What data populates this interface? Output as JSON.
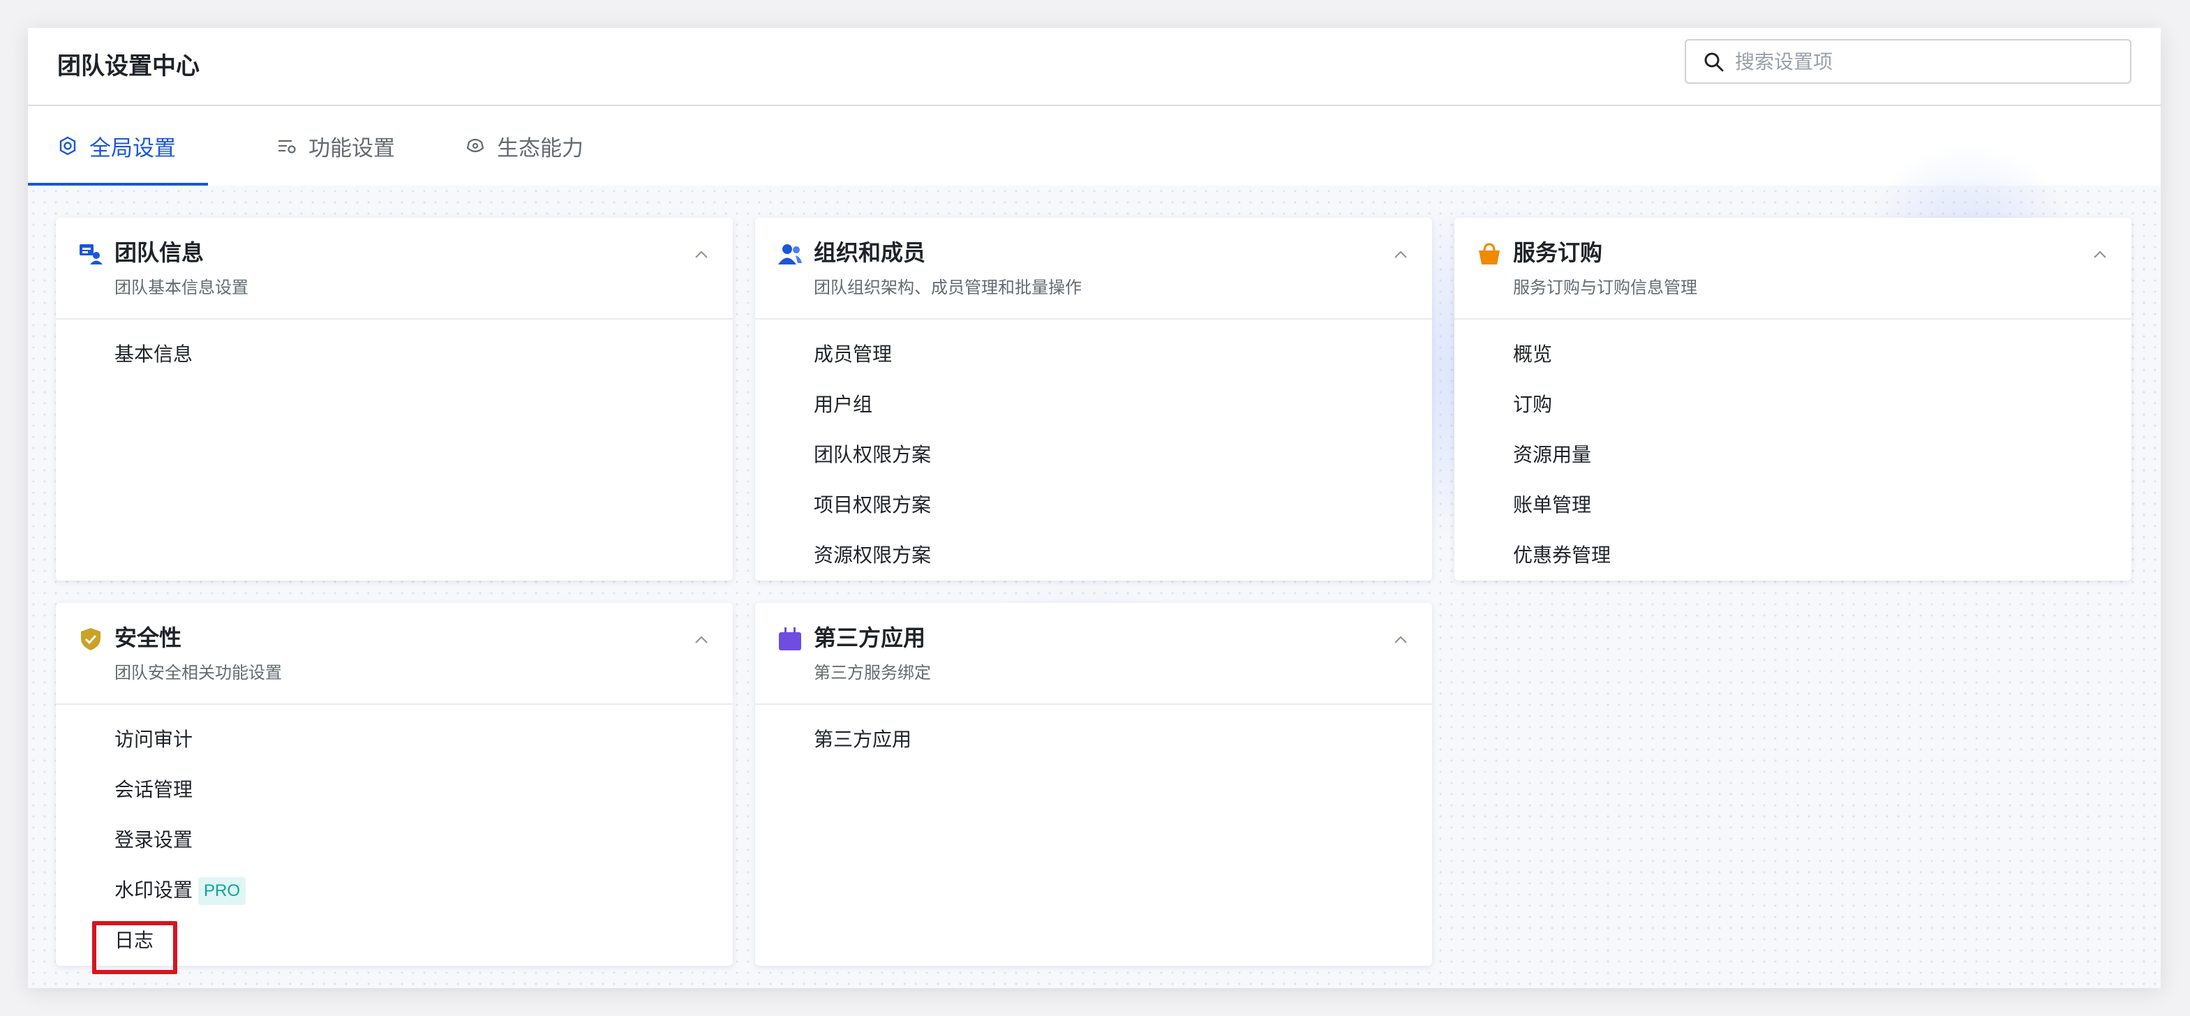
{
  "app": {
    "title": "团队设置中心"
  },
  "search": {
    "placeholder": "搜索设置项",
    "value": ""
  },
  "tabs": [
    {
      "label": "全局设置",
      "icon": "settings-icon",
      "active": true
    },
    {
      "label": "功能设置",
      "icon": "feature-settings-icon",
      "active": false
    },
    {
      "label": "生态能力",
      "icon": "ecosystem-icon",
      "active": false
    }
  ],
  "cards": {
    "team_info": {
      "title": "团队信息",
      "subtitle": "团队基本信息设置",
      "icon": "team-info-icon",
      "items": [
        "基本信息"
      ]
    },
    "org_members": {
      "title": "组织和成员",
      "subtitle": "团队组织架构、成员管理和批量操作",
      "icon": "members-icon",
      "items": [
        "成员管理",
        "用户组",
        "团队权限方案",
        "项目权限方案",
        "资源权限方案"
      ]
    },
    "service_order": {
      "title": "服务订购",
      "subtitle": "服务订购与订购信息管理",
      "icon": "shopping-basket-icon",
      "items": [
        "概览",
        "订购",
        "资源用量",
        "账单管理",
        "优惠券管理"
      ]
    },
    "security": {
      "title": "安全性",
      "subtitle": "团队安全相关功能设置",
      "icon": "shield-check-icon",
      "items": [
        "访问审计",
        "会话管理",
        "登录设置",
        "水印设置",
        "日志"
      ],
      "badge": "PRO"
    },
    "third_party": {
      "title": "第三方应用",
      "subtitle": "第三方服务绑定",
      "icon": "app-icon",
      "items": [
        "第三方应用"
      ]
    }
  },
  "colors": {
    "accent": "#1a56db",
    "highlight": "#d7141e",
    "pro_badge": "#10a59a"
  }
}
